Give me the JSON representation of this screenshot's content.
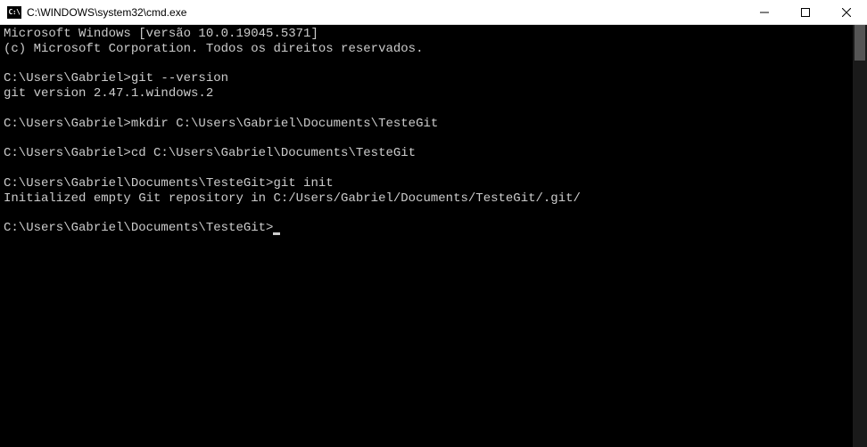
{
  "titlebar": {
    "icon_label": "C:\\",
    "title": "C:\\WINDOWS\\system32\\cmd.exe"
  },
  "terminal": {
    "lines": [
      {
        "prompt": "",
        "text": "Microsoft Windows [versão 10.0.19045.5371]"
      },
      {
        "prompt": "",
        "text": "(c) Microsoft Corporation. Todos os direitos reservados."
      },
      {
        "prompt": "",
        "text": ""
      },
      {
        "prompt": "C:\\Users\\Gabriel>",
        "text": "git --version"
      },
      {
        "prompt": "",
        "text": "git version 2.47.1.windows.2"
      },
      {
        "prompt": "",
        "text": ""
      },
      {
        "prompt": "C:\\Users\\Gabriel>",
        "text": "mkdir C:\\Users\\Gabriel\\Documents\\TesteGit"
      },
      {
        "prompt": "",
        "text": ""
      },
      {
        "prompt": "C:\\Users\\Gabriel>",
        "text": "cd C:\\Users\\Gabriel\\Documents\\TesteGit"
      },
      {
        "prompt": "",
        "text": ""
      },
      {
        "prompt": "C:\\Users\\Gabriel\\Documents\\TesteGit>",
        "text": "git init"
      },
      {
        "prompt": "",
        "text": "Initialized empty Git repository in C:/Users/Gabriel/Documents/TesteGit/.git/"
      },
      {
        "prompt": "",
        "text": ""
      }
    ],
    "active_prompt": "C:\\Users\\Gabriel\\Documents\\TesteGit>"
  }
}
